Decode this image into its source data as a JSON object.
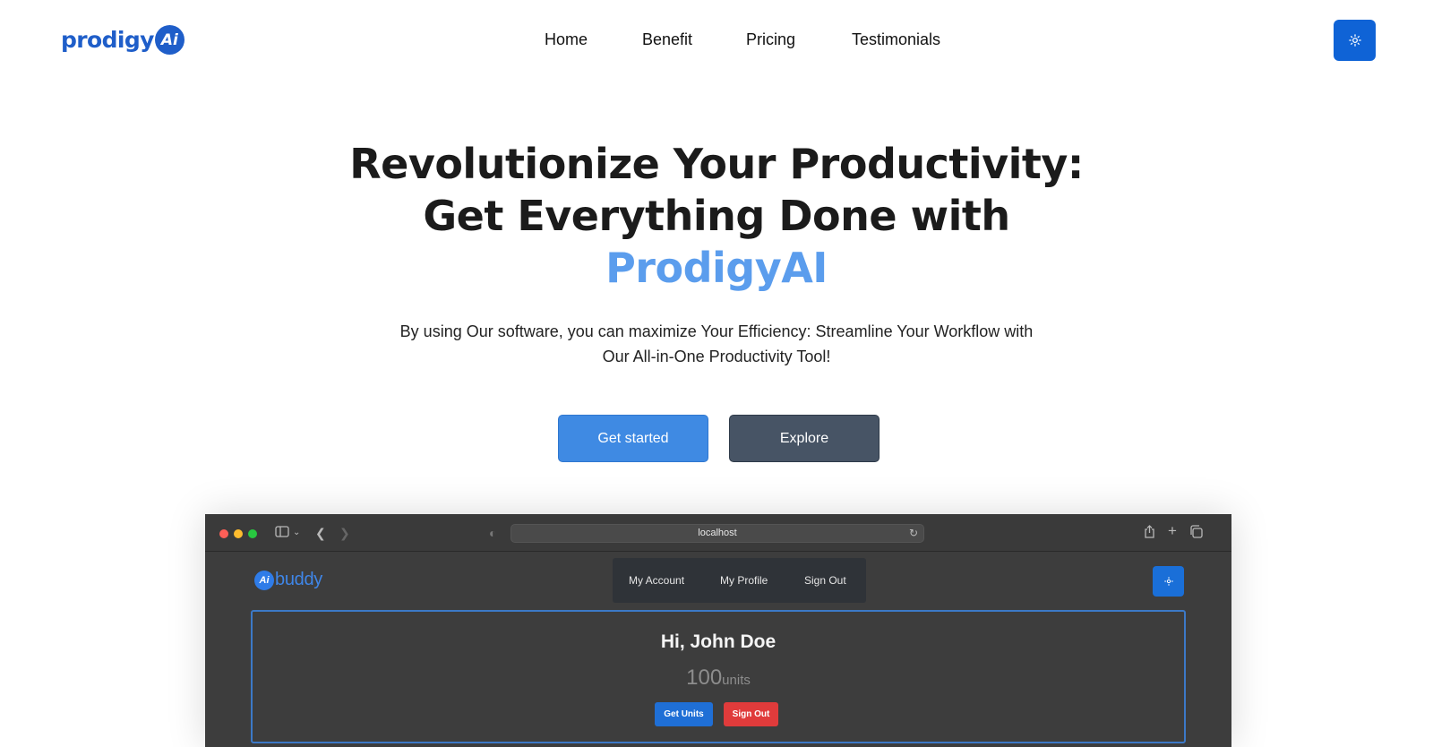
{
  "header": {
    "logo_text": "prodigy",
    "logo_badge": "Ai",
    "nav": [
      "Home",
      "Benefit",
      "Pricing",
      "Testimonials"
    ],
    "theme_icon": "sun-icon"
  },
  "hero": {
    "title_line1": "Revolutionize Your Productivity:",
    "title_line2": "Get Everything Done with",
    "title_brand": "ProdigyAI",
    "subtitle_line1": "By using Our software, you can maximize Your Efficiency: Streamline Your Workflow with",
    "subtitle_line2": "Our All-in-One Productivity Tool!",
    "cta_primary": "Get started",
    "cta_secondary": "Explore"
  },
  "preview": {
    "url": "localhost",
    "logo_badge": "Ai",
    "logo_text": "buddy",
    "nav": [
      "My Account",
      "My Profile",
      "Sign Out"
    ],
    "greeting": "Hi, John Doe",
    "units_value": "100",
    "units_label": "units",
    "btn_get_units": "Get Units",
    "btn_sign_out": "Sign Out"
  },
  "colors": {
    "brand_blue": "#1f5ec9",
    "accent_light_blue": "#5b9ded",
    "primary_button": "#3f8ae3",
    "secondary_button": "#475465",
    "danger": "#e03b3b"
  }
}
